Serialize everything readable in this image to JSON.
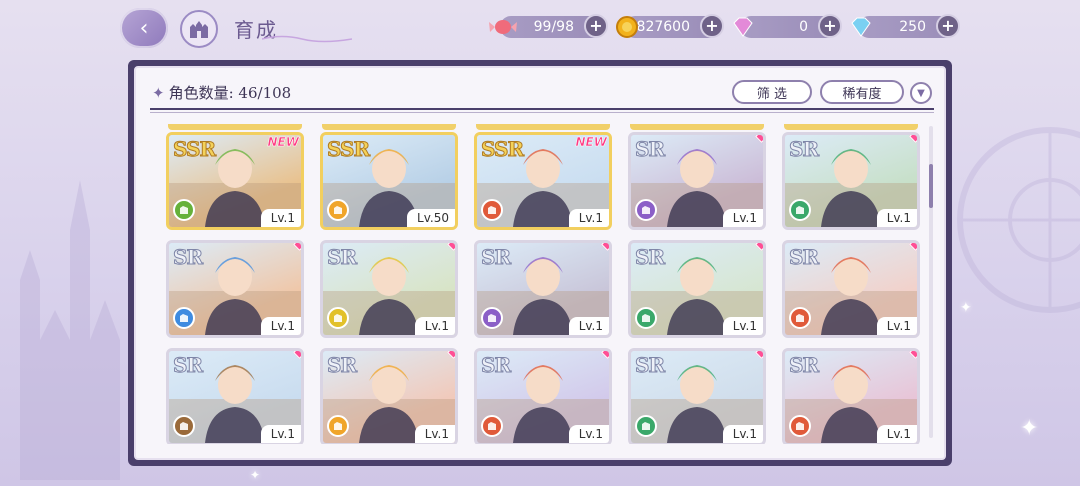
{
  "header": {
    "title": "育成",
    "resources": [
      {
        "name": "candy",
        "value": "99/98",
        "icon": "candy-icon",
        "color": "#e05a6a"
      },
      {
        "name": "gold",
        "value": "827600",
        "icon": "gold-coin-icon",
        "color": "#f2b21c"
      },
      {
        "name": "pink-diamond",
        "value": "0",
        "icon": "pink-diamond-icon",
        "color": "#e38ad8"
      },
      {
        "name": "blue-diamond",
        "value": "250",
        "icon": "blue-diamond-icon",
        "color": "#7ad0f2"
      }
    ]
  },
  "panel": {
    "count_label": "角色数量:",
    "count_value": "46/108",
    "filter_label": "筛 选",
    "rarity_label": "稀有度"
  },
  "cards": [
    {
      "rarity": "SSR",
      "new": true,
      "level": "Lv.1",
      "role_color": "#66b13a",
      "bg": "#e9c08a"
    },
    {
      "rarity": "SSR",
      "new": false,
      "level": "Lv.50",
      "role_color": "#f0a52a",
      "bg": "#b6cfe6"
    },
    {
      "rarity": "SSR",
      "new": true,
      "level": "Lv.1",
      "role_color": "#e05a3a",
      "bg": "#c9ddf0"
    },
    {
      "rarity": "SR",
      "new": false,
      "level": "Lv.1",
      "role_color": "#8b5fc7",
      "bg": "#cbbad6"
    },
    {
      "rarity": "SR",
      "new": false,
      "level": "Lv.1",
      "role_color": "#3aa86a",
      "bg": "#c6dfc6"
    },
    {
      "rarity": "SR",
      "new": false,
      "level": "Lv.1",
      "role_color": "#3e8be0",
      "bg": "#f0c6a6"
    },
    {
      "rarity": "SR",
      "new": false,
      "level": "Lv.1",
      "role_color": "#e2c12a",
      "bg": "#d8e4c4"
    },
    {
      "rarity": "SR",
      "new": false,
      "level": "Lv.1",
      "role_color": "#8b5fc7",
      "bg": "#c8c4d8"
    },
    {
      "rarity": "SR",
      "new": false,
      "level": "Lv.1",
      "role_color": "#3aa86a",
      "bg": "#d6e6d0"
    },
    {
      "rarity": "SR",
      "new": false,
      "level": "Lv.1",
      "role_color": "#e05a3a",
      "bg": "#f3d0c8"
    },
    {
      "rarity": "SR",
      "new": false,
      "level": "Lv.1",
      "role_color": "#9a6a3a",
      "bg": "#c9dcef"
    },
    {
      "rarity": "SR",
      "new": false,
      "level": "Lv.1",
      "role_color": "#f0a52a",
      "bg": "#f2c8b8"
    },
    {
      "rarity": "SR",
      "new": false,
      "level": "Lv.1",
      "role_color": "#e05a3a",
      "bg": "#d2c8ea"
    },
    {
      "rarity": "SR",
      "new": false,
      "level": "Lv.1",
      "role_color": "#3aa86a",
      "bg": "#cfdcea"
    },
    {
      "rarity": "SR",
      "new": false,
      "level": "Lv.1",
      "role_color": "#e05a3a",
      "bg": "#e8c3d6"
    }
  ]
}
